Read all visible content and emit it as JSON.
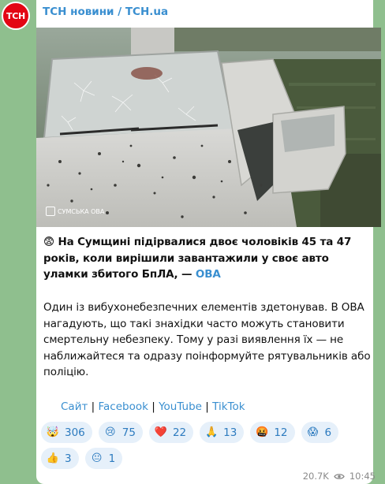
{
  "channel": {
    "avatar_text": "ТСН",
    "name": "ТСН новини / TCH.ua"
  },
  "photo": {
    "description_icon": "car-photo",
    "watermark_text": "СУМСЬКА ОВА"
  },
  "post": {
    "emoji": "😨",
    "headline_main": "На Сумщині підірвалися двоє чоловіків 45 та 47 років, коли вирішили завантажили у своє авто уламки збитого БпЛА, — ",
    "headline_link": "ОВА",
    "body": "Один із вибухонебезпечних елементів здетонував. В ОВА нагадують, що такі знахідки часто можуть становити смертельну небезпеку. Тому у разі виявлення їх — не наближайтеся та одразу поінформуйте рятувальників або поліцію."
  },
  "links": [
    {
      "label": "Сайт"
    },
    {
      "label": "Facebook"
    },
    {
      "label": "YouTube"
    },
    {
      "label": "TikTok"
    }
  ],
  "link_separator": " | ",
  "reactions": [
    {
      "icon": "exploding-head",
      "emoji": "🤯",
      "count": "306"
    },
    {
      "icon": "crying-face",
      "emoji": "😢",
      "count": "75"
    },
    {
      "icon": "red-heart",
      "emoji": "❤️",
      "count": "22"
    },
    {
      "icon": "praying-hands",
      "emoji": "🙏",
      "count": "13"
    },
    {
      "icon": "swearing-face",
      "emoji": "🤬",
      "count": "12"
    },
    {
      "icon": "screaming-face",
      "emoji": "😱",
      "count": "6"
    },
    {
      "icon": "thumbs-up",
      "emoji": "👍",
      "count": "3"
    },
    {
      "icon": "neutral-face",
      "emoji": "😐",
      "count": "1"
    }
  ],
  "meta": {
    "views": "20.7K",
    "time": "10:45"
  },
  "colors": {
    "accent": "#3a8fd0",
    "avatar_bg": "#e30613",
    "chat_bg": "#8fbf8e"
  }
}
